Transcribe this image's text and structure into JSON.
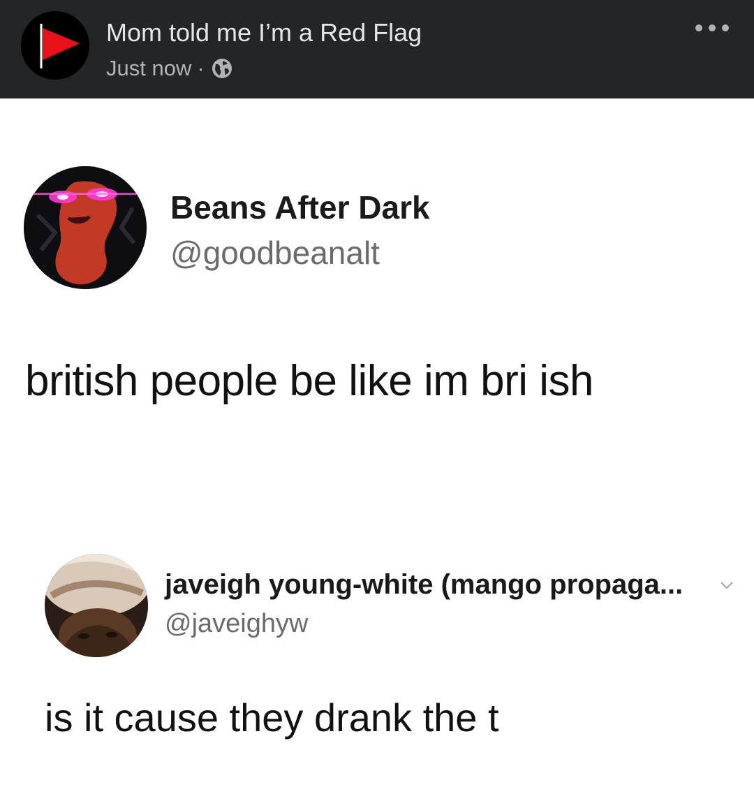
{
  "post": {
    "page_name": "Mom told me I’m a Red Flag",
    "timestamp": "Just now",
    "separator": "·",
    "privacy_icon": "globe-icon",
    "more_icon": "more-options-icon"
  },
  "tweets": [
    {
      "display_name": "Beans After Dark",
      "handle": "@goodbeanalt",
      "text": "british people be like im bri ish"
    },
    {
      "display_name": "javeigh young-white (mango propaga...",
      "handle": "@javeighyw",
      "text": "is it cause they drank the t"
    }
  ],
  "colors": {
    "header_bg": "#242526",
    "header_text": "#e4e6eb",
    "header_secondary": "#b0b3b8",
    "flag_red": "#e8111a",
    "body_bg": "#ffffff",
    "handle_gray": "#6b6b6b"
  }
}
